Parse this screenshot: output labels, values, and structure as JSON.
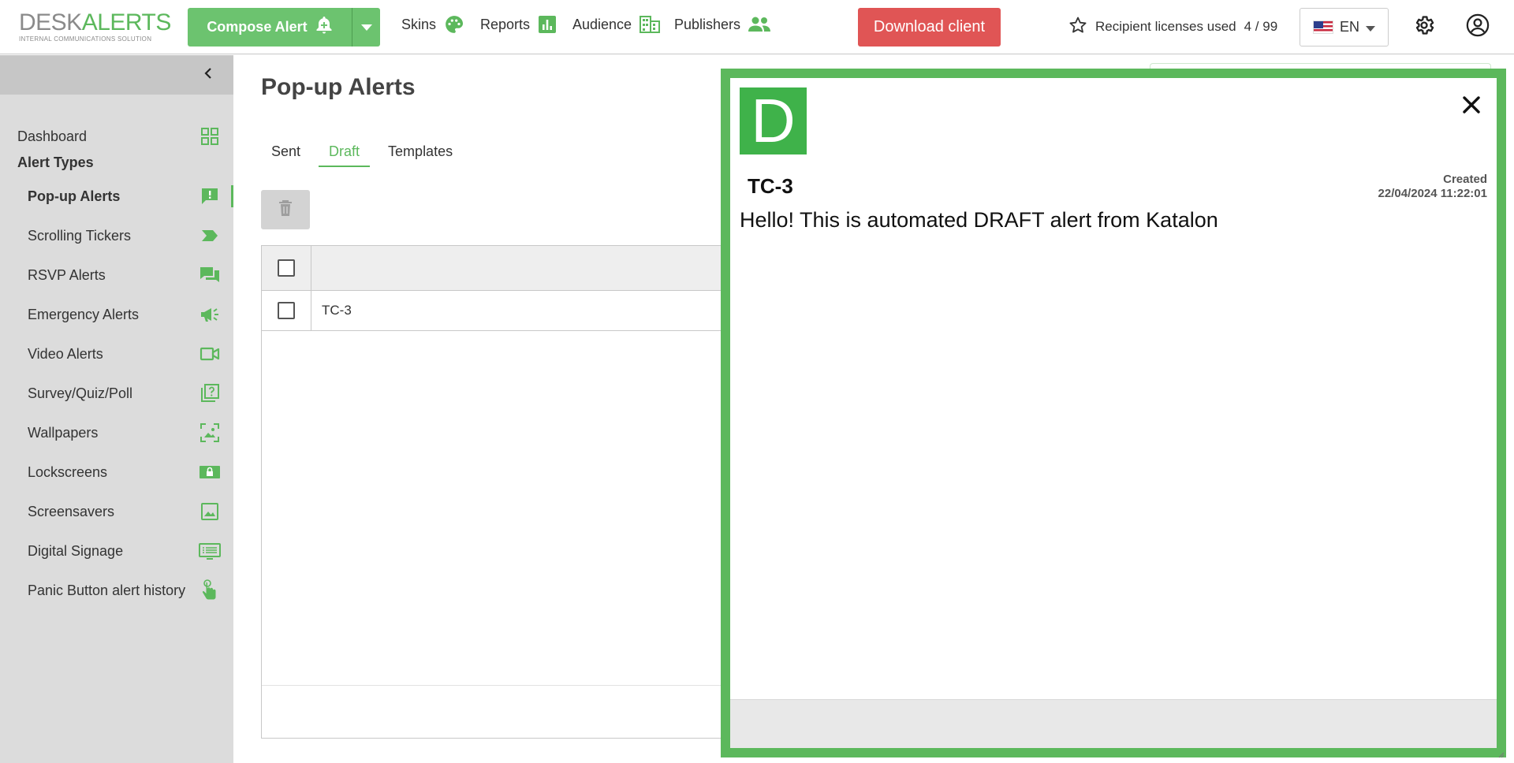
{
  "brand": {
    "name_part1": "DESK",
    "name_part2": "ALERTS",
    "tagline": "INTERNAL COMMUNICATIONS SOLUTION",
    "primary_color": "#5cb85c",
    "danger_color": "#e05555"
  },
  "header": {
    "compose_label": "Compose Alert",
    "nav": [
      {
        "label": "Skins",
        "icon": "palette-icon"
      },
      {
        "label": "Reports",
        "icon": "bar-chart-icon"
      },
      {
        "label": "Audience",
        "icon": "building-icon"
      },
      {
        "label": "Publishers",
        "icon": "people-icon"
      }
    ],
    "download_label": "Download client",
    "licenses_label": "Recipient licenses used",
    "licenses_value": "4 / 99",
    "language": "EN"
  },
  "sidebar": {
    "dashboard": "Dashboard",
    "section_title": "Alert Types",
    "items": [
      {
        "label": "Pop-up Alerts",
        "icon": "exclamation-chat-icon",
        "active": true
      },
      {
        "label": "Scrolling Tickers",
        "icon": "ticker-icon"
      },
      {
        "label": "RSVP Alerts",
        "icon": "chat-bubbles-icon"
      },
      {
        "label": "Emergency Alerts",
        "icon": "megaphone-icon"
      },
      {
        "label": "Video Alerts",
        "icon": "video-camera-icon"
      },
      {
        "label": "Survey/Quiz/Poll",
        "icon": "question-stack-icon"
      },
      {
        "label": "Wallpapers",
        "icon": "wallpaper-icon"
      },
      {
        "label": "Lockscreens",
        "icon": "lock-screen-icon"
      },
      {
        "label": "Screensavers",
        "icon": "image-icon"
      },
      {
        "label": "Digital Signage",
        "icon": "signage-icon"
      },
      {
        "label": "Panic Button alert history",
        "icon": "touch-hand-icon"
      }
    ]
  },
  "main": {
    "title": "Pop-up Alerts",
    "tabs": [
      {
        "label": "Sent",
        "active": false
      },
      {
        "label": "Draft",
        "active": true
      },
      {
        "label": "Templates",
        "active": false
      }
    ],
    "rows": [
      {
        "name": "TC-3",
        "checked": false
      }
    ]
  },
  "popup": {
    "logo_letter": "D",
    "title": "TC-3",
    "created_label": "Created",
    "created_value": "22/04/2024 11:22:01",
    "body": "Hello! This is automated DRAFT alert from Katalon"
  }
}
